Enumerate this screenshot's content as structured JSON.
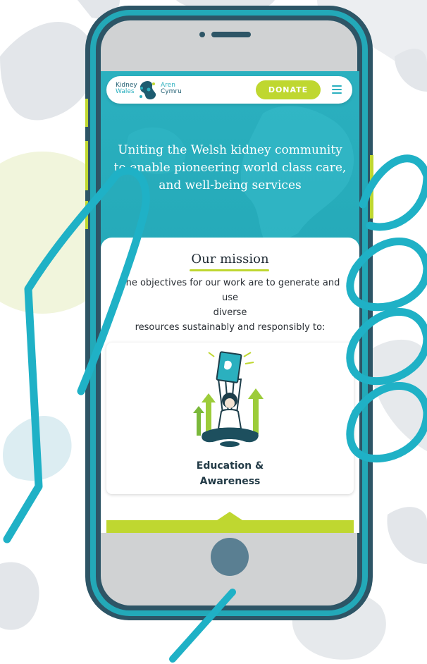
{
  "logo": {
    "left_line1": "Kidney",
    "left_line2": "Wales",
    "right_line1": "Aren",
    "right_line2": "Cymru"
  },
  "nav": {
    "donate_label": "DONATE",
    "menu_icon": "hamburger-menu-icon"
  },
  "hero": {
    "line1": "Uniting the Welsh kidney community",
    "line2": "to enable pioneering world class care,",
    "line3": "and well-being services"
  },
  "mission": {
    "title": "Our mission",
    "text_line1": "The objectives for our work are to generate and use",
    "text_line2": "diverse",
    "text_line3": "resources sustainably and responsibly to:"
  },
  "objective": {
    "title_line1": "Education &",
    "title_line2": "Awareness",
    "illustration": "person-holding-book-illustration"
  },
  "colors": {
    "teal": "#2bb0bf",
    "dark_teal": "#1d5c70",
    "lime": "#bfd730",
    "phone_frame": "#23a9b8",
    "phone_bezel": "#2d5566"
  }
}
